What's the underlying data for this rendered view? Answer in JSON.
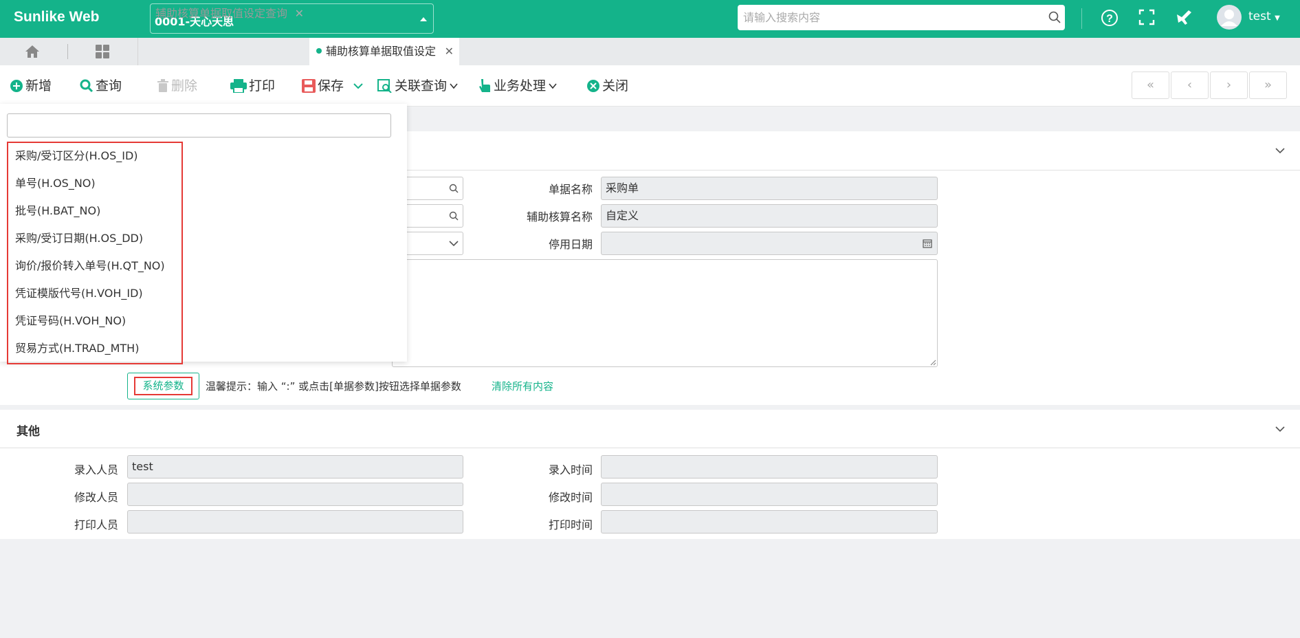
{
  "app": {
    "title": "Sunlike Web",
    "company": "0001-天心天思",
    "search_placeholder": "请输入搜索内容",
    "user": "test"
  },
  "tabs": [
    {
      "label": "辅助核算单据取值设定查询"
    },
    {
      "label": "辅助核算单据取值设定"
    }
  ],
  "toolbar": {
    "add": "新增",
    "query": "查询",
    "delete": "删除",
    "print": "打印",
    "save": "保存",
    "related": "关联查询",
    "business": "业务处理",
    "close": "关闭"
  },
  "nav": {
    "first": "«",
    "prev": "‹",
    "next": "›",
    "last": "»"
  },
  "form": {
    "doc_name_label": "单据名称",
    "doc_name_value": "采购单",
    "aux_name_label": "辅助核算名称",
    "aux_name_value": "自定义",
    "stop_date_label": "停用日期",
    "stop_date_value": ""
  },
  "dropdown": {
    "items": [
      "采购/受订区分(H.OS_ID)",
      "单号(H.OS_NO)",
      "批号(H.BAT_NO)",
      "采购/受订日期(H.OS_DD)",
      "询价/报价转入单号(H.QT_NO)",
      "凭证模版代号(H.VOH_ID)",
      "凭证号码(H.VOH_NO)",
      "贸易方式(H.TRAD_MTH)"
    ]
  },
  "hint": {
    "sys_param": "系统参数",
    "tip": "温馨提示：输入 “:” 或点击[单据参数]按钮选择单据参数",
    "clear": "清除所有内容"
  },
  "other": {
    "title": "其他",
    "entry_person_label": "录入人员",
    "entry_person_value": "test",
    "entry_time_label": "录入时间",
    "entry_time_value": "",
    "modify_person_label": "修改人员",
    "modify_person_value": "",
    "modify_time_label": "修改时间",
    "modify_time_value": "",
    "print_person_label": "打印人员",
    "print_person_value": "",
    "print_time_label": "打印时间",
    "print_time_value": ""
  }
}
